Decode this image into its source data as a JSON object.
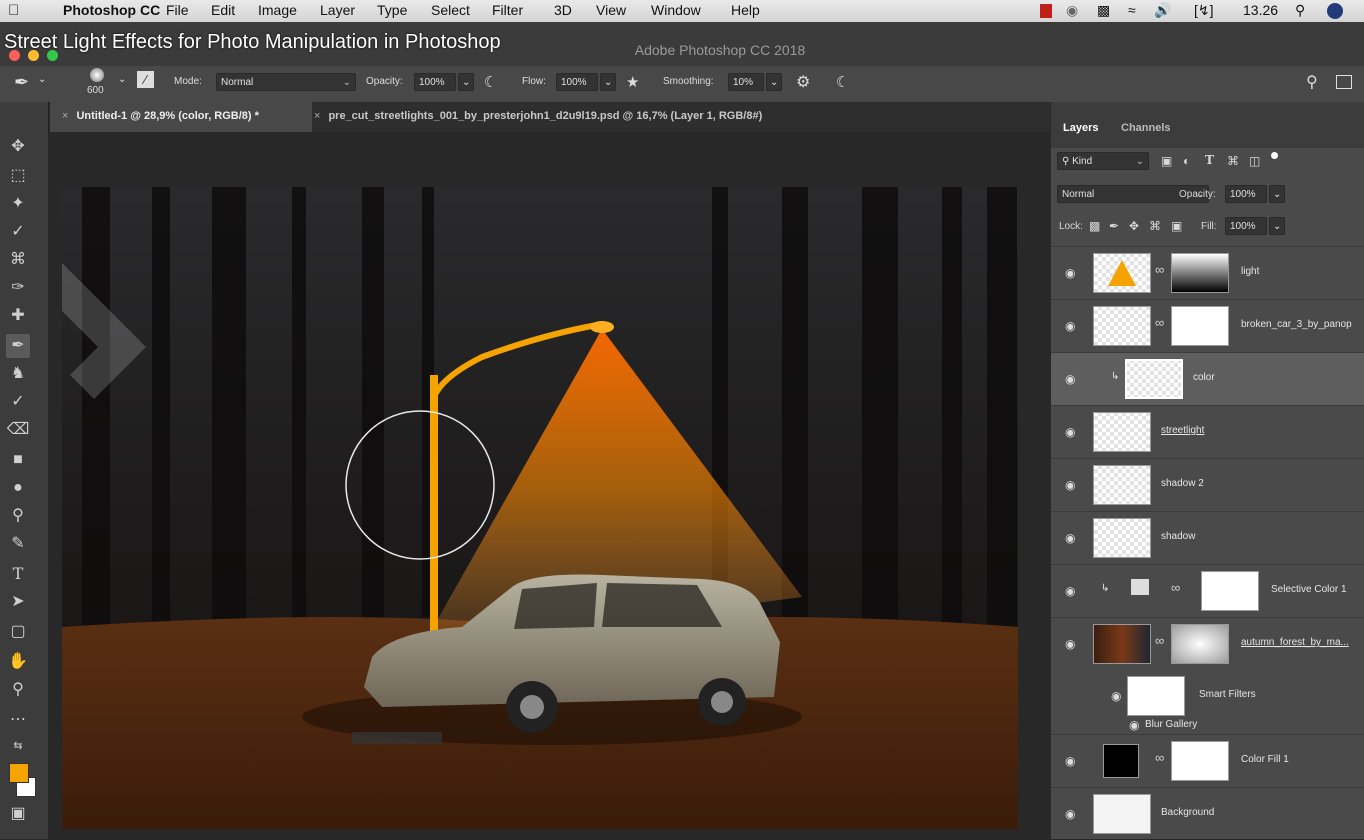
{
  "overlay_title": "Street Light Effects for Photo Manipulation in Photoshop",
  "menubar": {
    "app": "Photoshop CC",
    "items": [
      "File",
      "Edit",
      "Image",
      "Layer",
      "Type",
      "Select",
      "Filter",
      "3D",
      "View",
      "Window",
      "Help"
    ],
    "clock": "13.26"
  },
  "window_title": "Adobe Photoshop CC 2018",
  "options": {
    "brush_size": "600",
    "mode_label": "Mode:",
    "mode_value": "Normal",
    "opacity_label": "Opacity:",
    "opacity_value": "100%",
    "flow_label": "Flow:",
    "flow_value": "100%",
    "smoothing_label": "Smoothing:",
    "smoothing_value": "10%"
  },
  "tabs": [
    {
      "label": "Untitled-1 @ 28,9% (color, RGB/8) *"
    },
    {
      "label": "pre_cut_streetlights_001_by_presterjohn1_d2u9l19.psd @ 16,7% (Layer 1, RGB/8#)"
    }
  ],
  "panel": {
    "tabs": [
      "Layers",
      "Channels"
    ],
    "kind_label": "Kind",
    "blend_mode": "Normal",
    "opacity_label": "Opacity:",
    "opacity_value": "100%",
    "lock_label": "Lock:",
    "fill_label": "Fill:",
    "fill_value": "100%",
    "layers": [
      {
        "name": "light"
      },
      {
        "name": "broken_car_3_by_panop"
      },
      {
        "name": "color"
      },
      {
        "name": "streetlight"
      },
      {
        "name": "shadow 2"
      },
      {
        "name": "shadow"
      },
      {
        "name": "Selective Color 1"
      },
      {
        "name": "autumn_forest_by_ma..."
      },
      {
        "name": "Smart Filters"
      },
      {
        "name": "Blur Gallery"
      },
      {
        "name": "Color Fill 1"
      },
      {
        "name": "Background"
      }
    ]
  },
  "colors": {
    "foreground": "#f5a300",
    "background": "#ffffff",
    "light_cone": "#ff8a00"
  }
}
